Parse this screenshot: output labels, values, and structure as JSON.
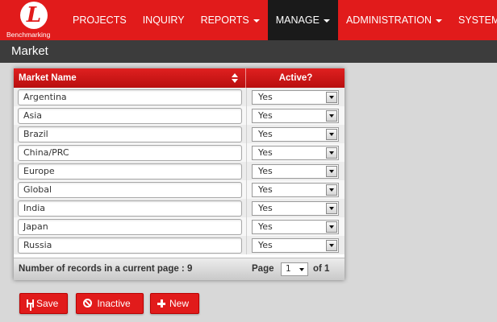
{
  "brand": {
    "logo_letter": "L",
    "name": "Benchmarking"
  },
  "nav": [
    {
      "label": "PROJECTS",
      "dropdown": false,
      "active": false
    },
    {
      "label": "INQUIRY",
      "dropdown": false,
      "active": false
    },
    {
      "label": "REPORTS",
      "dropdown": true,
      "active": false
    },
    {
      "label": "MANAGE",
      "dropdown": true,
      "active": true
    },
    {
      "label": "ADMINISTRATION",
      "dropdown": true,
      "active": false
    },
    {
      "label": "SYSTEM",
      "dropdown": true,
      "active": false
    }
  ],
  "page": {
    "title": "Market"
  },
  "table": {
    "columns": {
      "name": "Market Name",
      "active": "Active?"
    },
    "rows": [
      {
        "name": "Argentina",
        "active": "Yes"
      },
      {
        "name": "Asia",
        "active": "Yes"
      },
      {
        "name": "Brazil",
        "active": "Yes"
      },
      {
        "name": "China/PRC",
        "active": "Yes"
      },
      {
        "name": "Europe",
        "active": "Yes"
      },
      {
        "name": "Global",
        "active": "Yes"
      },
      {
        "name": "India",
        "active": "Yes"
      },
      {
        "name": "Japan",
        "active": "Yes"
      },
      {
        "name": "Russia",
        "active": "Yes"
      }
    ],
    "footer": {
      "records_text": "Number of records in a current page : 9",
      "page_label": "Page",
      "page_value": "1",
      "of_text": "of 1"
    }
  },
  "buttons": {
    "save": "Save",
    "inactive": "Inactive",
    "new": "New"
  },
  "colors": {
    "brand_red": "#e11b1b",
    "nav_active": "#1a1a1a",
    "title_bar": "#3c3c3c",
    "page_bg": "#d8d8d8"
  }
}
